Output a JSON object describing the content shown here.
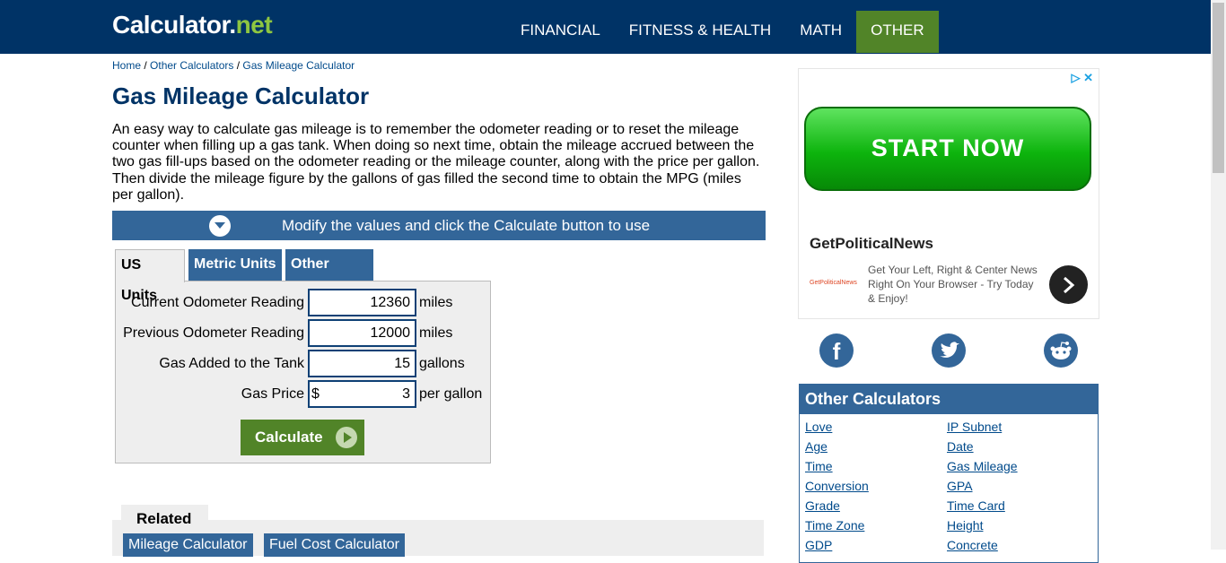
{
  "header": {
    "logo_main": "Calculator.",
    "logo_net": "net",
    "nav": [
      "FINANCIAL",
      "FITNESS & HEALTH",
      "MATH",
      "OTHER"
    ],
    "active_nav": "OTHER"
  },
  "breadcrumb": {
    "home": "Home",
    "sep1": " / ",
    "other": "Other Calculators",
    "sep2": " / ",
    "current": "Gas Mileage Calculator"
  },
  "page": {
    "title": "Gas Mileage Calculator",
    "intro": "An easy way to calculate gas mileage is to remember the odometer reading or to reset the mileage counter when filling up a gas tank. When doing so next time, obtain the mileage accrued between the two gas fill-ups based on the odometer reading or the mileage counter, along with the price per gallon. Then divide the mileage figure by the gallons of gas filled the second time to obtain the MPG (miles per gallon).",
    "modify_text": "Modify the values and click the Calculate button to use"
  },
  "tabs": {
    "us": "US Units",
    "metric": "Metric Units",
    "other": "Other Units"
  },
  "form": {
    "current_label": "Current Odometer Reading",
    "current_value": "12360",
    "current_unit": "miles",
    "previous_label": "Previous Odometer Reading",
    "previous_value": "12000",
    "previous_unit": "miles",
    "gas_label": "Gas Added to the Tank",
    "gas_value": "15",
    "gas_unit": "gallons",
    "price_label": "Gas Price",
    "price_prefix": "$",
    "price_value": "3",
    "price_unit": "per gallon",
    "calculate_label": "Calculate"
  },
  "related": {
    "label": "Related",
    "links": [
      "Mileage Calculator",
      "Fuel Cost Calculator"
    ]
  },
  "ad": {
    "cta": "START NOW",
    "brand": "GetPoliticalNews",
    "logo_text": "GetPoliticalNews",
    "body": "Get Your Left, Right & Center News Right On Your Browser - Try Today & Enjoy!"
  },
  "other_calculators": {
    "title": "Other Calculators",
    "left": [
      "Love",
      "Age",
      "Time",
      "Conversion",
      "Grade",
      "Time Zone",
      "GDP"
    ],
    "right": [
      "IP Subnet",
      "Date",
      "Gas Mileage",
      "GPA",
      "Time Card",
      "Height",
      "Concrete"
    ]
  },
  "colors": {
    "header_bg": "#003366",
    "accent_blue": "#336699",
    "accent_green": "#518428",
    "logo_green": "#8ec641"
  }
}
